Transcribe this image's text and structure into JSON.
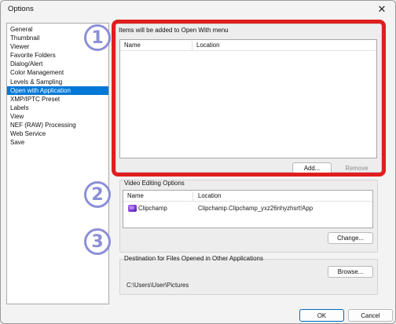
{
  "window": {
    "title": "Options",
    "close_glyph": "✕"
  },
  "sidebar": {
    "items": [
      {
        "label": "General",
        "selected": false
      },
      {
        "label": "Thumbnail",
        "selected": false
      },
      {
        "label": "Viewer",
        "selected": false
      },
      {
        "label": "Favorite Folders",
        "selected": false
      },
      {
        "label": "Dialog/Alert",
        "selected": false
      },
      {
        "label": "Color Management",
        "selected": false
      },
      {
        "label": "Levels & Sampling",
        "selected": false
      },
      {
        "label": "Open with Application",
        "selected": true
      },
      {
        "label": "XMP/IPTC Preset",
        "selected": false
      },
      {
        "label": "Labels",
        "selected": false
      },
      {
        "label": "View",
        "selected": false
      },
      {
        "label": "NEF (RAW) Processing",
        "selected": false
      },
      {
        "label": "Web Service",
        "selected": false
      },
      {
        "label": "Save",
        "selected": false
      }
    ]
  },
  "open_with": {
    "label": "Items will be added to Open With menu",
    "columns": [
      "Name",
      "Location"
    ],
    "rows": [],
    "add_label": "Add...",
    "remove_label": "Remove"
  },
  "video_editing": {
    "label": "Video Editing Options",
    "columns": [
      "Name",
      "Location"
    ],
    "rows": [
      {
        "name": "Clipchamp",
        "location": "Clipchamp.Clipchamp_yxz26nhyzhsrt!App",
        "icon": "clipchamp-icon"
      }
    ],
    "change_label": "Change..."
  },
  "destination": {
    "label": "Destination for Files Opened in Other Applications",
    "browse_label": "Browse...",
    "path": "C:\\Users\\User\\Pictures"
  },
  "footer": {
    "ok_label": "OK",
    "cancel_label": "Cancel"
  },
  "annotations": {
    "markers": [
      "1",
      "2",
      "3"
    ],
    "highlight_color": "#e01e1e",
    "marker_color": "#8b8fd8"
  },
  "colors": {
    "selection": "#0078d7",
    "background": "#f3f3f3"
  }
}
